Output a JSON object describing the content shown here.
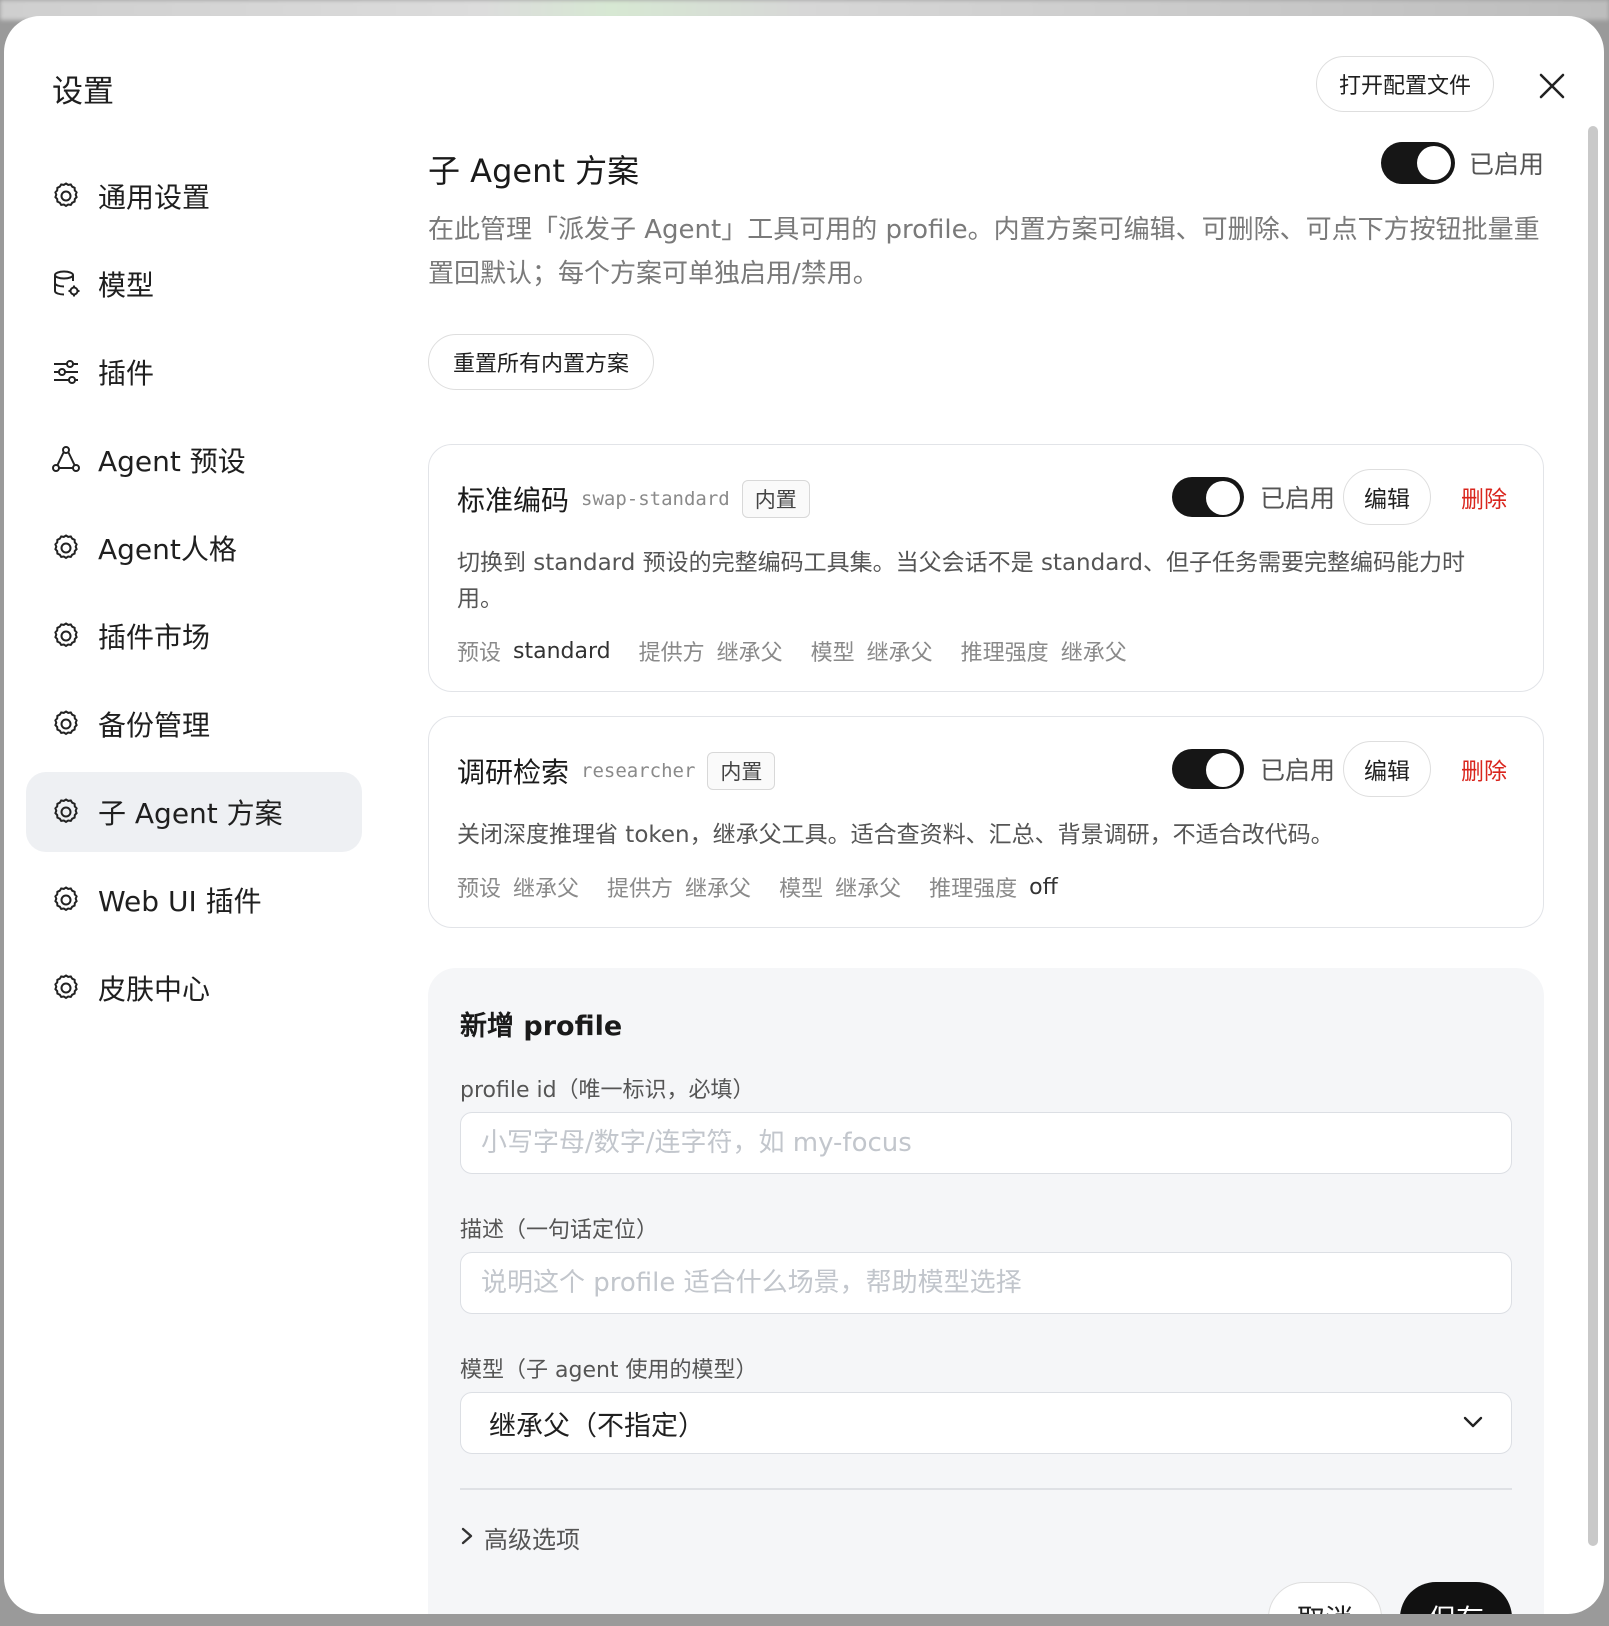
{
  "dialog": {
    "title": "设置",
    "open_config_label": "打开配置文件"
  },
  "sidebar": {
    "items": [
      {
        "label": "通用设置",
        "icon": "gear-icon"
      },
      {
        "label": "模型",
        "icon": "database-gear-icon"
      },
      {
        "label": "插件",
        "icon": "sliders-icon"
      },
      {
        "label": "Agent 预设",
        "icon": "nodes-icon"
      },
      {
        "label": "Agent人格",
        "icon": "gear-icon"
      },
      {
        "label": "插件市场",
        "icon": "gear-icon"
      },
      {
        "label": "备份管理",
        "icon": "gear-icon"
      },
      {
        "label": "子 Agent 方案",
        "icon": "gear-icon",
        "active": true
      },
      {
        "label": "Web UI 插件",
        "icon": "gear-icon"
      },
      {
        "label": "皮肤中心",
        "icon": "gear-icon"
      }
    ]
  },
  "section": {
    "title": "子 Agent 方案",
    "enabled_label": "已启用",
    "description": "在此管理「派发子 Agent」工具可用的 profile。内置方案可编辑、可删除、可点下方按钮批量重置回默认；每个方案可单独启用/禁用。",
    "reset_label": "重置所有内置方案"
  },
  "profiles": [
    {
      "name": "标准编码",
      "id": "swap-standard",
      "badge": "内置",
      "enabled_label": "已启用",
      "edit_label": "编辑",
      "delete_label": "删除",
      "description": "切换到 standard 预设的完整编码工具集。当父会话不是 standard、但子任务需要完整编码能力时用。",
      "meta": [
        {
          "key": "预设",
          "value": "standard"
        },
        {
          "key": "提供方",
          "value": "继承父"
        },
        {
          "key": "模型",
          "value": "继承父"
        },
        {
          "key": "推理强度",
          "value": "继承父"
        }
      ]
    },
    {
      "name": "调研检索",
      "id": "researcher",
      "badge": "内置",
      "enabled_label": "已启用",
      "edit_label": "编辑",
      "delete_label": "删除",
      "description": "关闭深度推理省 token，继承父工具。适合查资料、汇总、背景调研，不适合改代码。",
      "meta": [
        {
          "key": "预设",
          "value": "继承父"
        },
        {
          "key": "提供方",
          "value": "继承父"
        },
        {
          "key": "模型",
          "value": "继承父"
        },
        {
          "key": "推理强度",
          "value": "off"
        }
      ]
    }
  ],
  "add_form": {
    "title": "新增 profile",
    "id_label": "profile id（唯一标识，必填）",
    "id_placeholder": "小写字母/数字/连字符，如 my-focus",
    "desc_label": "描述（一句话定位）",
    "desc_placeholder": "说明这个 profile 适合什么场景，帮助模型选择",
    "model_label": "模型（子 agent 使用的模型）",
    "model_value": "继承父（不指定）",
    "advanced_label": "高级选项",
    "cancel_label": "取消",
    "save_label": "保存"
  }
}
